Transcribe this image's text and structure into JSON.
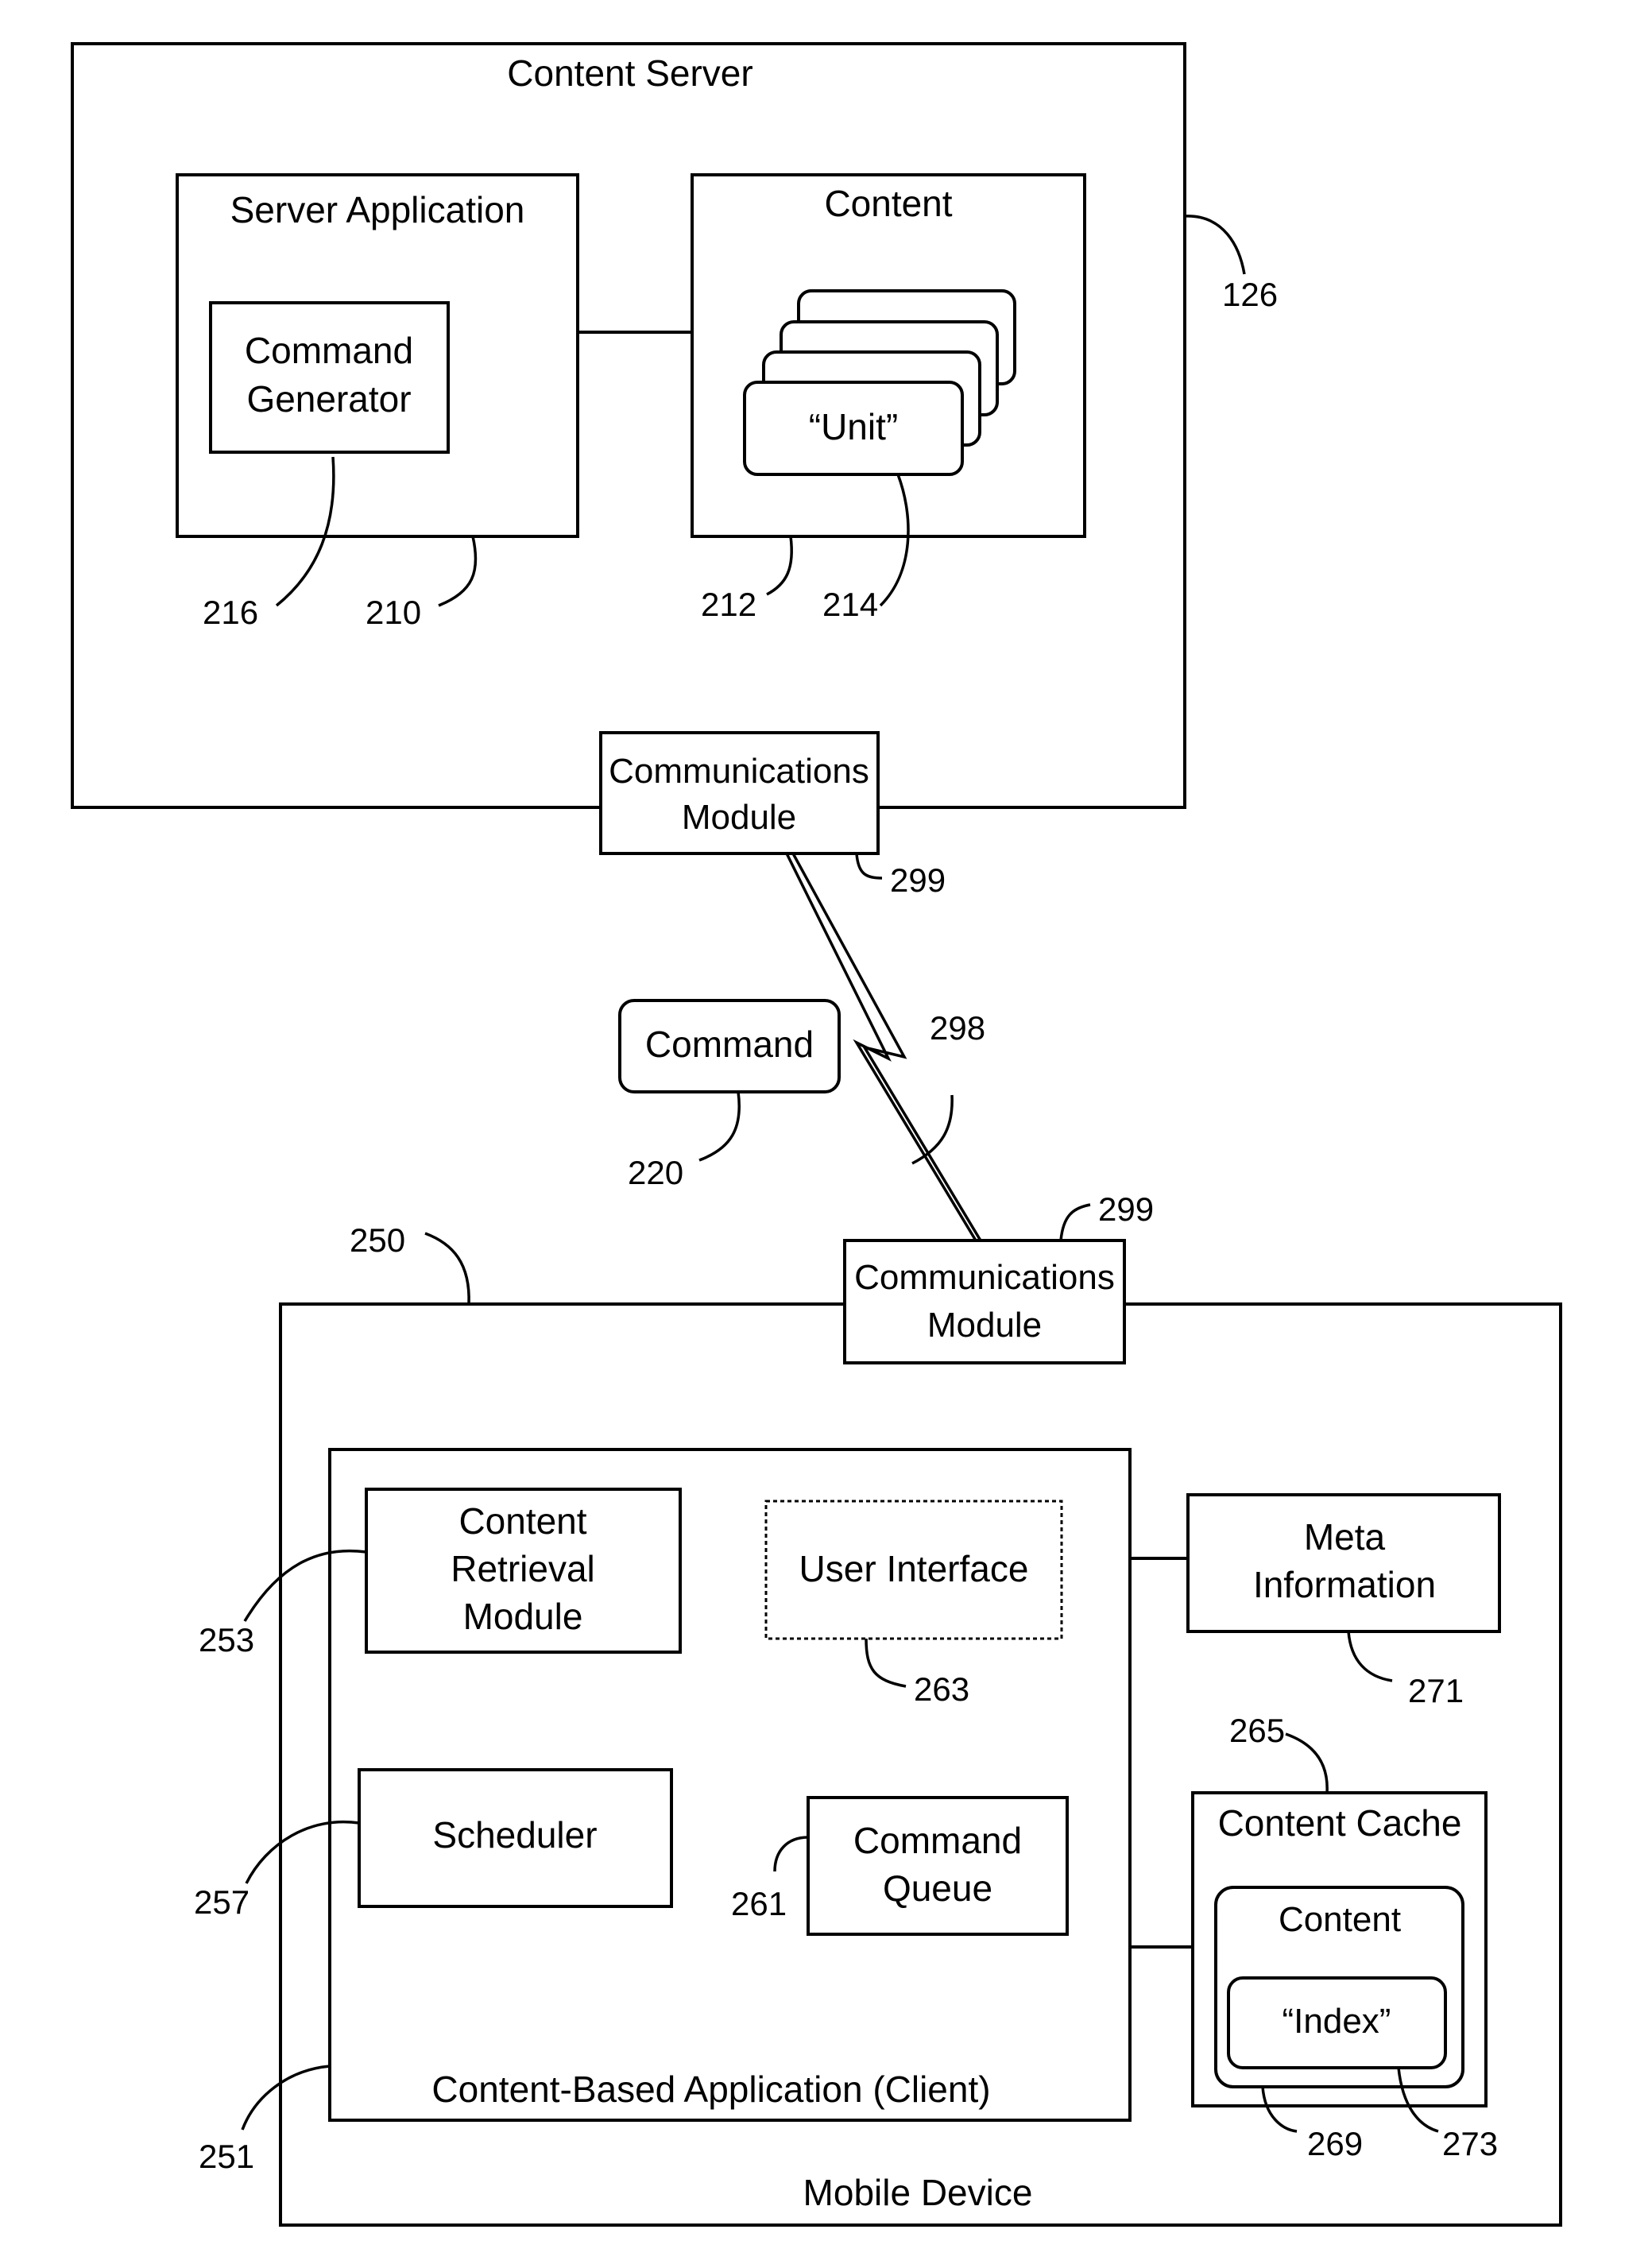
{
  "figure": {
    "content_server": {
      "label": "Content Server",
      "ref": "126"
    },
    "server_application": {
      "label": "Server Application",
      "ref": "210"
    },
    "command_generator": {
      "line1": "Command",
      "line2": "Generator",
      "ref": "216"
    },
    "content_store": {
      "label": "Content",
      "ref": "212"
    },
    "unit": {
      "label": "“Unit”",
      "ref": "214"
    },
    "server_comms": {
      "line1": "Communications",
      "line2": "Module",
      "ref": "299"
    },
    "link": {
      "ref": "298"
    },
    "command": {
      "label": "Command",
      "ref": "220"
    },
    "device_comms": {
      "line1": "Communications",
      "line2": "Module",
      "ref": "299"
    },
    "mobile_device": {
      "label": "Mobile Device",
      "ref": "250"
    },
    "client_app": {
      "label": "Content-Based Application (Client)",
      "ref": "251"
    },
    "content_retrieval": {
      "line1": "Content",
      "line2": "Retrieval",
      "line3": "Module",
      "ref": "253"
    },
    "user_interface": {
      "label": "User Interface",
      "ref": "263"
    },
    "scheduler": {
      "label": "Scheduler",
      "ref": "257"
    },
    "command_queue": {
      "line1": "Command",
      "line2": "Queue",
      "ref": "261"
    },
    "meta_information": {
      "line1": "Meta",
      "line2": "Information",
      "ref": "271"
    },
    "content_cache": {
      "label": "Content Cache",
      "ref": "265"
    },
    "cached_content": {
      "label": "Content",
      "ref": "269"
    },
    "index": {
      "label": "“Index”",
      "ref": "273"
    }
  }
}
